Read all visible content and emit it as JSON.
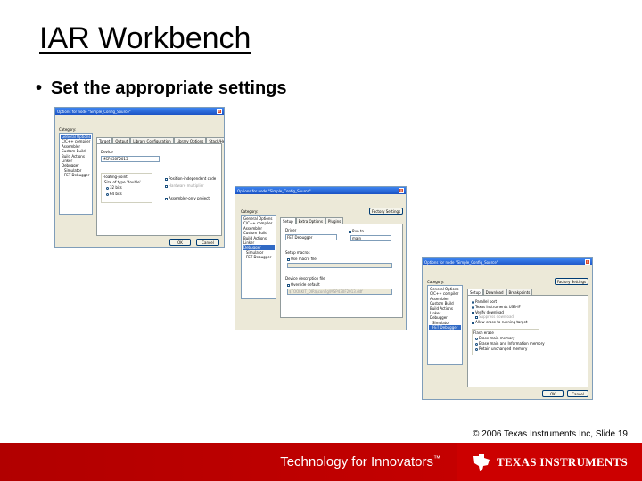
{
  "slide": {
    "title": "IAR Workbench",
    "bullet": "Set the appropriate settings",
    "copyright": "© 2006 Texas Instruments Inc, Slide 19",
    "tagline": "Technology for Innovators",
    "tagline_mark": "™",
    "brand": "TEXAS INSTRUMENTS"
  },
  "dialog_common": {
    "title": "Options for node \"Simple_Config_Source\"",
    "category_label": "Category:",
    "ok_label": "OK",
    "cancel_label": "Cancel",
    "categories": [
      {
        "label": "General Options",
        "sub": false
      },
      {
        "label": "C/C++ compiler",
        "sub": false
      },
      {
        "label": "Assembler",
        "sub": false
      },
      {
        "label": "Custom Build",
        "sub": false
      },
      {
        "label": "Build Actions",
        "sub": false
      },
      {
        "label": "Linker",
        "sub": false
      },
      {
        "label": "Debugger",
        "sub": false
      },
      {
        "label": "Simulator",
        "sub": true
      },
      {
        "label": "FET Debugger",
        "sub": true
      }
    ]
  },
  "dialog1": {
    "tabs": [
      "Target",
      "Output",
      "Library Configuration",
      "Library Options",
      "Stack/Heap"
    ],
    "device_label": "Device",
    "device_value": "MSP430F2013",
    "floating_label": "Floating-point",
    "size_label": "Size of type 'double'",
    "opt_32": "32 bits",
    "opt_64": "64 bits",
    "pos_indep": "Position-independent code",
    "hw_mult": "Hardware multiplier",
    "assembler_only": "Assembler-only project"
  },
  "dialog2": {
    "factory_label": "Factory Settings",
    "tabs": [
      "Setup",
      "Extra Options",
      "Plugins"
    ],
    "driver_label": "Driver",
    "driver_value": "FET Debugger",
    "run_to_label": "Run to",
    "run_to_value": "main",
    "setup_macros_label": "Setup macros",
    "use_macro_file": "Use macro file",
    "device_desc_label": "Device description file",
    "override_default": "Override default",
    "device_desc_value": "$TOOLKIT_DIR$\\config\\MSP430F2013.ddf"
  },
  "dialog3": {
    "factory_label": "Factory Settings",
    "tabs": [
      "Setup",
      "Download",
      "Breakpoints"
    ],
    "parallel_port": "Parallel port",
    "texas_usb": "Texas Instruments USB-IF",
    "verify_download": "Verify download",
    "suppress_download": "Suppress download",
    "attach_running": "Allow erase to running target",
    "flash_erase_label": "Flash erase",
    "erase_main": "Erase main memory",
    "erase_main_info": "Erase main and Information memory",
    "retain_memory": "Retain unchanged memory"
  }
}
